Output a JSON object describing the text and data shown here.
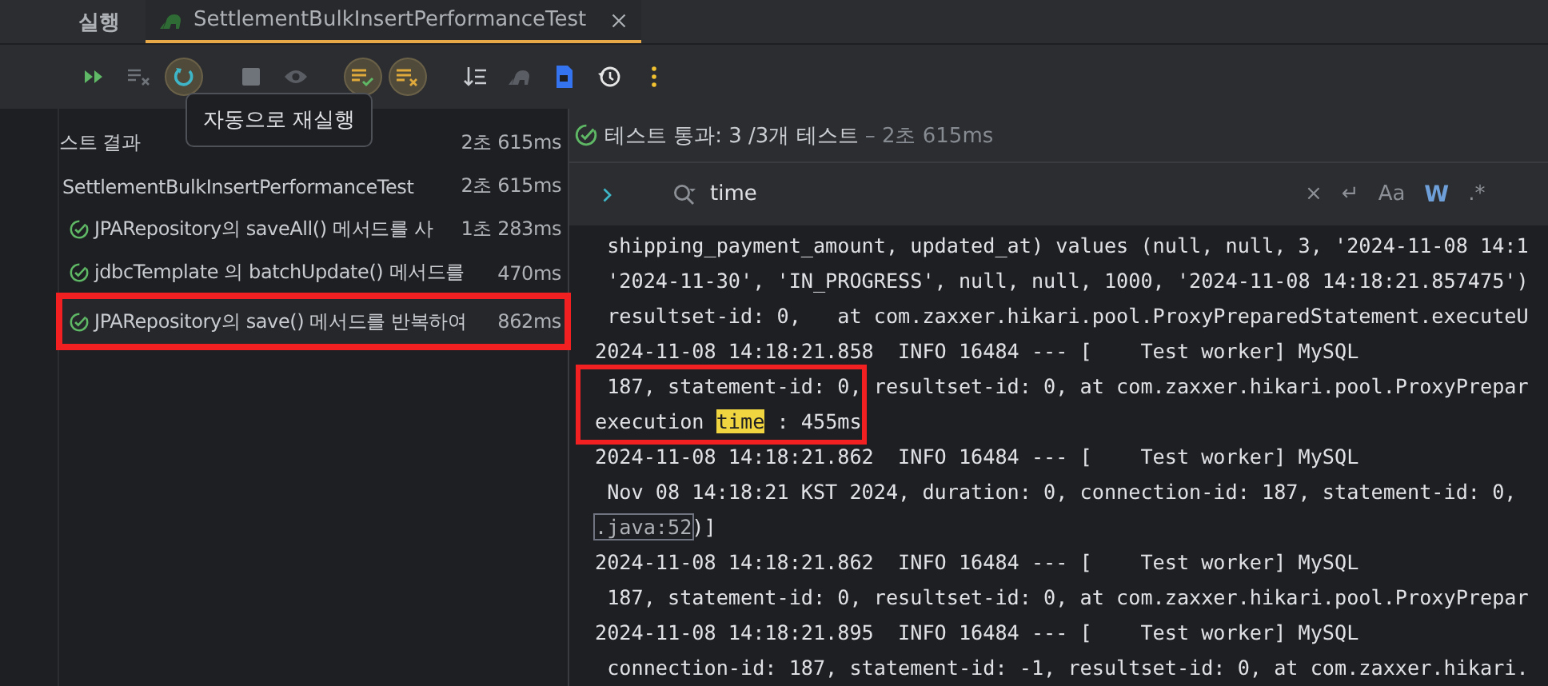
{
  "tool_window": {
    "title": "실행"
  },
  "tabs": [
    {
      "label": "SettlementBulkInsertPerformanceTest",
      "selected": true
    }
  ],
  "toolbar": [
    {
      "kind": "rerun",
      "on": false
    },
    {
      "kind": "clear",
      "on": false
    },
    {
      "kind": "auto-rerun",
      "on": true
    },
    {
      "kind": "stop",
      "on": false
    },
    {
      "kind": "eye",
      "on": false
    },
    {
      "kind": "show-passed",
      "on": true
    },
    {
      "kind": "show-ignored",
      "on": true
    },
    {
      "kind": "sort",
      "on": false
    },
    {
      "kind": "elephant",
      "on": false
    },
    {
      "kind": "file",
      "on": false
    },
    {
      "kind": "history",
      "on": false
    },
    {
      "kind": "more",
      "on": false
    }
  ],
  "tooltip": {
    "text": "자동으로 재실행"
  },
  "tree": [
    {
      "label": "스트 결과",
      "time": "2초 615ms",
      "passed": false,
      "selected": false,
      "children": [
        {
          "label": "SettlementBulkInsertPerformanceTest",
          "time": "2초 615ms",
          "passed": false,
          "selected": false,
          "children": [
            {
              "label": "JPARepository의 saveAll() 메서드를 사",
              "time": "1초 283ms",
              "passed": true,
              "selected": false,
              "marked": false
            },
            {
              "label": "jdbcTemplate 의 batchUpdate() 메서드를",
              "time": "470ms",
              "passed": true,
              "selected": false,
              "marked": false
            },
            {
              "label": "JPARepository의 save() 메서드를 반복하여",
              "time": "862ms",
              "passed": true,
              "selected": true,
              "marked": true
            }
          ]
        }
      ]
    }
  ],
  "status": {
    "passed": true,
    "summary": "테스트 통과: 3 /3개 테스트",
    "duration": "– 2초 615ms"
  },
  "search": {
    "value": "time",
    "options": [
      "×",
      "↵",
      "Aa",
      "W",
      ".*"
    ]
  },
  "console": [
    {
      "marked": false,
      "segments": [
        {
          "kind": "plain",
          "text": " shipping_payment_amount, updated_at) values (null, null, 3, '2024-11-08 14:1"
        }
      ]
    },
    {
      "marked": false,
      "segments": [
        {
          "kind": "plain",
          "text": " '2024-11-30', 'IN_PROGRESS', null, null, 1000, '2024-11-08 14:18:21.857475')"
        }
      ]
    },
    {
      "marked": false,
      "segments": [
        {
          "kind": "plain",
          "text": " resultset-id: 0,   at com.zaxxer.hikari.pool.ProxyPreparedStatement.executeU"
        }
      ]
    },
    {
      "marked": false,
      "segments": [
        {
          "kind": "plain",
          "text": "2024-11-08 14:18:21.858  INFO 16484 --- [    Test worker] MySQL"
        }
      ]
    },
    {
      "marked": true,
      "segments": [
        {
          "kind": "plain",
          "text": " 187, statement-id: 0, resultset-id: 0, at com.zaxxer.hikari.pool.ProxyPrepar"
        }
      ]
    },
    {
      "marked": true,
      "segments": [
        {
          "kind": "plain",
          "text": "execution "
        },
        {
          "kind": "match",
          "text": "time"
        },
        {
          "kind": "plain",
          "text": " : 455ms"
        }
      ]
    },
    {
      "marked": false,
      "segments": [
        {
          "kind": "plain",
          "text": "2024-11-08 14:18:21.862  INFO 16484 --- [    Test worker] MySQL"
        }
      ]
    },
    {
      "marked": false,
      "segments": [
        {
          "kind": "plain",
          "text": " Nov 08 14:18:21 KST 2024, duration: 0, connection-id: 187, statement-id: 0,"
        }
      ]
    },
    {
      "marked": false,
      "segments": [
        {
          "kind": "link",
          "text": ".java:52"
        },
        {
          "kind": "plain",
          "text": ")]"
        }
      ]
    },
    {
      "marked": false,
      "segments": [
        {
          "kind": "plain",
          "text": "2024-11-08 14:18:21.862  INFO 16484 --- [    Test worker] MySQL"
        }
      ]
    },
    {
      "marked": false,
      "segments": [
        {
          "kind": "plain",
          "text": " 187, statement-id: 0, resultset-id: 0, at com.zaxxer.hikari.pool.ProxyPrepar"
        }
      ]
    },
    {
      "marked": false,
      "segments": [
        {
          "kind": "plain",
          "text": "2024-11-08 14:18:21.895  INFO 16484 --- [    Test worker] MySQL"
        }
      ]
    },
    {
      "marked": false,
      "segments": [
        {
          "kind": "plain",
          "text": " connection-id: 187, statement-id: -1, resultset-id: 0, at com.zaxxer.hikari."
        }
      ]
    }
  ]
}
